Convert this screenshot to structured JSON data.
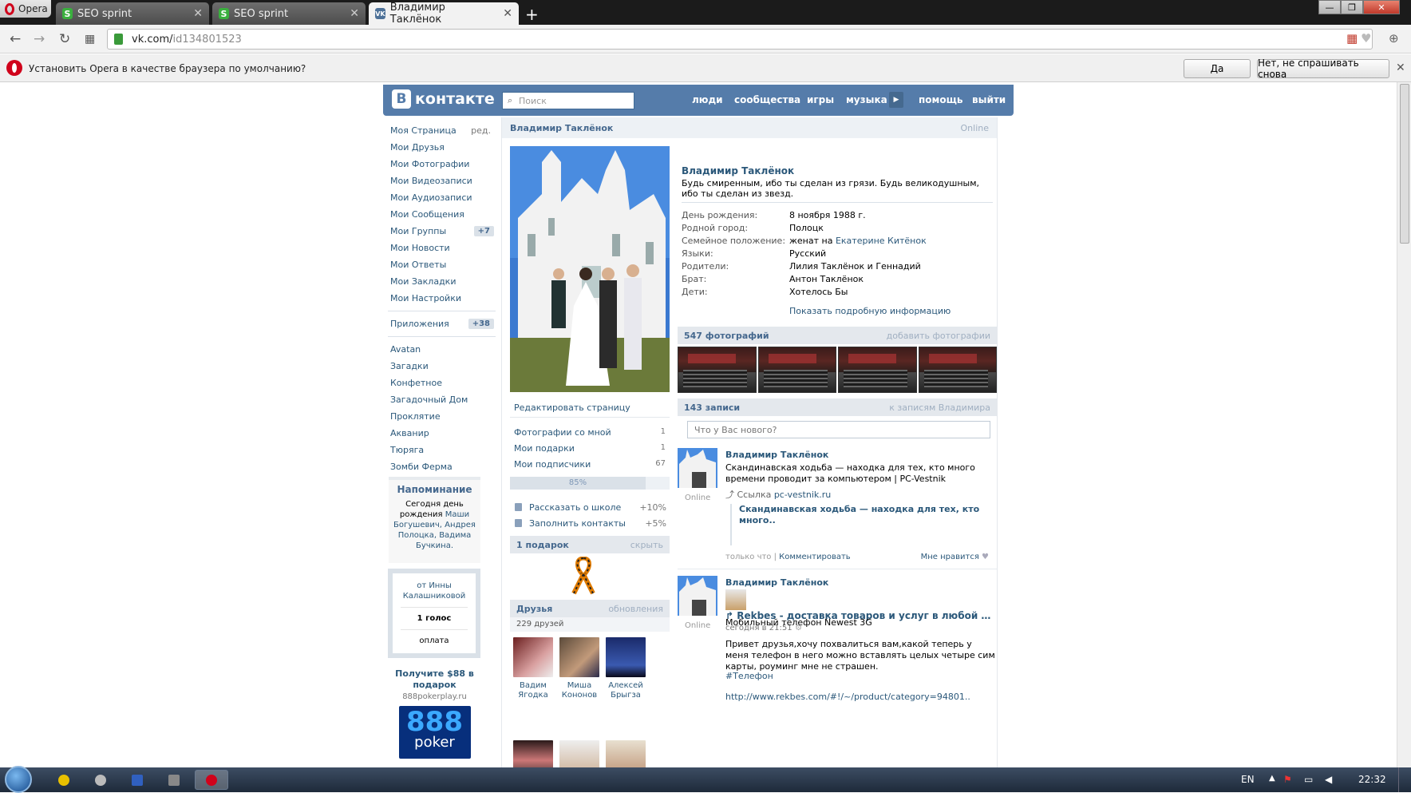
{
  "browser": {
    "menu_label": "Opera",
    "tabs": [
      {
        "title": "SEO sprint",
        "icon": "seo-sprint-icon",
        "active": false
      },
      {
        "title": "SEO sprint",
        "icon": "seo-sprint-icon",
        "active": false
      },
      {
        "title": "Владимир Таклёнок",
        "icon": "vk-icon",
        "active": true
      }
    ],
    "url_host": "vk.com/",
    "url_path": "id134801523",
    "infobar": {
      "message": "Установить Opera в качестве браузера по умолчанию?",
      "yes_label": "Да",
      "no_label": "Нет, не спрашивать снова"
    }
  },
  "vk": {
    "logo_text": "контакте",
    "search_placeholder": "Поиск",
    "nav": [
      "люди",
      "сообщества",
      "игры",
      "музыка",
      "помощь",
      "выйти"
    ],
    "menu": [
      {
        "label": "Моя Страница",
        "extra": "ред."
      },
      {
        "label": "Мои Друзья"
      },
      {
        "label": "Мои Фотографии"
      },
      {
        "label": "Мои Видеозаписи"
      },
      {
        "label": "Мои Аудиозаписи"
      },
      {
        "label": "Мои Сообщения"
      },
      {
        "label": "Мои Группы",
        "badge": "+7"
      },
      {
        "label": "Мои Новости"
      },
      {
        "label": "Мои Ответы"
      },
      {
        "label": "Мои Закладки"
      },
      {
        "label": "Мои Настройки"
      }
    ],
    "apps": {
      "label": "Приложения",
      "badge": "+38"
    },
    "app_list": [
      "Avatan",
      "Загадки",
      "Конфетное",
      "Загадочный Дом",
      "Проклятие",
      "Акваниp",
      "Тюряга",
      "Зомби Ферма"
    ],
    "reminder": {
      "title": "Напоминание",
      "text_a": "Сегодня ",
      "text_b": "день рождения",
      "names": "Маши Богушевич, Андрея Полоцка, Вадима Бучкина."
    },
    "poll": {
      "from": "от Инны Калашниковой",
      "votes": "1 голос",
      "action": "оплата"
    },
    "ad": {
      "title": "Получите $88 в подарок",
      "site": "888pokerplay.ru",
      "logo_num": "888",
      "logo_word": "poker"
    }
  },
  "profile": {
    "header_name": "Владимир Таклёнок",
    "header_status": "Online",
    "name": "Владимир Таклёнок",
    "status": "Будь смиренным, ибо ты сделан из грязи. Будь великодушным, ибо ты сделан из звезд.",
    "info": [
      {
        "label": "День рождения:",
        "value": "8 ноября 1988 г.",
        "link": true
      },
      {
        "label": "Родной город:",
        "value": "Полоцк",
        "link": true
      },
      {
        "label": "Семейное положение:",
        "value": "женат на ",
        "link_value": "Екатерине Китёнок"
      },
      {
        "label": "Языки:",
        "value": "Русский",
        "link": true
      },
      {
        "label": "Родители:",
        "value": "Лилия Таклёнок и Геннадий",
        "link": false
      },
      {
        "label": "Брат:",
        "value": "Антон Таклёнок",
        "link": true
      },
      {
        "label": "Дети:",
        "value": "Хотелось Бы",
        "link": false
      }
    ],
    "more_info": "Показать подробную информацию",
    "edit_page": "Редактировать страницу",
    "links": [
      {
        "label": "Фотографии со мной",
        "count": "1"
      },
      {
        "label": "Мои подарки",
        "count": "1"
      },
      {
        "label": "Мои подписчики",
        "count": "67"
      }
    ],
    "progress": {
      "label": "85%",
      "value": 0.85
    },
    "tips": [
      {
        "label": "Рассказать о школе",
        "pct": "+10%"
      },
      {
        "label": "Заполнить контакты",
        "pct": "+5%"
      }
    ],
    "gifts": {
      "title": "1 подарок",
      "action": "скрыть"
    },
    "friends": {
      "title": "Друзья",
      "action": "обновления",
      "count": "229 друзей",
      "list": [
        {
          "first": "Вадим",
          "last": "Ягодка"
        },
        {
          "first": "Миша",
          "last": "Кононов"
        },
        {
          "first": "Алексей",
          "last": "Брыгза"
        }
      ]
    },
    "photos": {
      "title": "547 фотографий",
      "action": "добавить фотографии"
    },
    "wall": {
      "title": "143 записи",
      "action": "к записям Владимира",
      "placeholder": "Что у Вас нового?",
      "posts": [
        {
          "author": "Владимир Таклёнок",
          "online": "Online",
          "text": "Скандинавская ходьба — находка для тех, кто много времени проводит за компьютером | PC-Vestnik",
          "src_label": "Ссылка ",
          "src_link": "pc-vestnik.ru",
          "quote": "Скандинавская ходьба — находка для тех, кто много..",
          "time": "только что",
          "comment": "Комментировать",
          "like": "Мне нравится"
        },
        {
          "author": "Владимир Таклёнок",
          "online": "Online",
          "repost_title": "Rekbes - доставка товаров и услуг в любой …",
          "repost_time": "сегодня в 21:51",
          "line1": "Мобильный телефон Newest 3G",
          "line2": "Привет друзья,хочу похвалиться вам,какой теперь у меня телефон в него можно вставлять целых четыре сим карты, роуминг мне не страшен.",
          "hashtag": "#Телефон",
          "link": "http://www.rekbes.com/#!/~/product/category=94801.."
        }
      ]
    }
  },
  "taskbar": {
    "lang": "EN",
    "time": "22:32"
  },
  "colors": {
    "vk_blue": "#557caa",
    "link": "#2b587a",
    "accent_red": "#d0021b"
  }
}
